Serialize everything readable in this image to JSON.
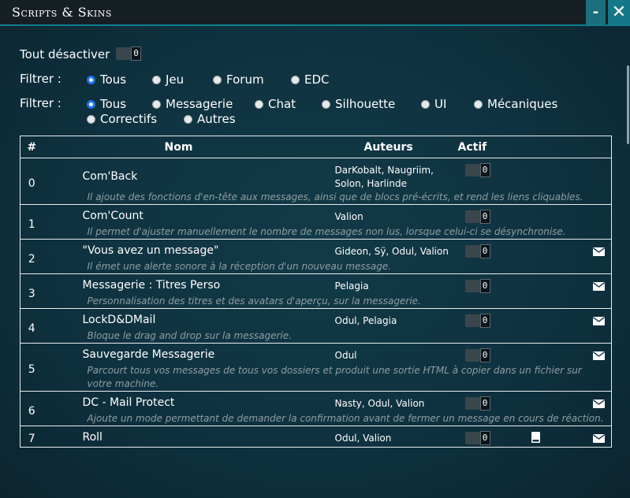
{
  "window": {
    "title": "Scripts & Skins",
    "minimize_label": "-",
    "close_label": "✕"
  },
  "disable_all": {
    "label": "Tout désactiver",
    "toggle_value": "0"
  },
  "filter1": {
    "label": "Filtrer :",
    "options": [
      {
        "label": "Tous",
        "checked": true
      },
      {
        "label": "Jeu",
        "checked": false
      },
      {
        "label": "Forum",
        "checked": false
      },
      {
        "label": "EDC",
        "checked": false
      }
    ]
  },
  "filter2": {
    "label": "Filtrer :",
    "options": [
      {
        "label": "Tous",
        "checked": true
      },
      {
        "label": "Messagerie",
        "checked": false
      },
      {
        "label": "Chat",
        "checked": false
      },
      {
        "label": "Silhouette",
        "checked": false
      },
      {
        "label": "UI",
        "checked": false
      },
      {
        "label": "Mécaniques",
        "checked": false
      },
      {
        "label": "Correctifs",
        "checked": false
      },
      {
        "label": "Autres",
        "checked": false
      }
    ]
  },
  "table": {
    "headers": {
      "num": "#",
      "name": "Nom",
      "authors": "Auteurs",
      "active": "Actif"
    },
    "rows": [
      {
        "num": "0",
        "name": "Com'Back",
        "authors": "DarKobalt, Naugriim, Solon, Harlinde",
        "toggle": "0",
        "mail_icon": false,
        "book_icon": false,
        "description": "Il ajoute des fonctions d'en-tête aux messages, ainsi que de blocs pré-écrits, et rend les liens cliquables."
      },
      {
        "num": "1",
        "name": "Com'Count",
        "authors": "Valion",
        "toggle": "0",
        "mail_icon": false,
        "book_icon": false,
        "description": "Il permet d'ajuster manuellement le nombre de messages non lus, lorsque celui-ci se désynchronise."
      },
      {
        "num": "2",
        "name": "\"Vous avez un message\"",
        "authors": "Gideon, Sÿ, Odul, Valion",
        "toggle": "0",
        "mail_icon": true,
        "book_icon": false,
        "description": "Il émet une alerte sonore à la réception d'un nouveau message."
      },
      {
        "num": "3",
        "name": "Messagerie : Titres Perso",
        "authors": "Pelagia",
        "toggle": "0",
        "mail_icon": true,
        "book_icon": false,
        "description": "Personnalisation des titres et des avatars d'aperçu, sur la messagerie."
      },
      {
        "num": "4",
        "name": "LockD&DMail",
        "authors": "Odul, Pelagia",
        "toggle": "0",
        "mail_icon": true,
        "book_icon": false,
        "description": "Bloque le drag and drop sur la messagerie."
      },
      {
        "num": "5",
        "name": "Sauvegarde Messagerie",
        "authors": "Odul",
        "toggle": "0",
        "mail_icon": true,
        "book_icon": false,
        "description": "Parcourt tous vos messages de tous vos dossiers et produit une sortie HTML à copier dans un fichier sur votre machine."
      },
      {
        "num": "6",
        "name": "DC - Mail Protect",
        "authors": "Nasty, Odul, Valion",
        "toggle": "0",
        "mail_icon": true,
        "book_icon": false,
        "description": "Ajoute un mode permettant de demander la confirmation avant de fermer un message en cours de réaction."
      },
      {
        "num": "7",
        "name": "Roll",
        "authors": "Odul, Valion",
        "toggle": "0",
        "mail_icon": true,
        "book_icon": true,
        "description": ""
      }
    ]
  },
  "icons": {
    "mail": "envelope-icon",
    "book": "book-icon"
  },
  "colors": {
    "accent": "#1b6e7c",
    "background": "#0f3240",
    "titlebar": "#161f24",
    "radio_checked": "#1a73e8",
    "description_text": "#8e9ea3"
  }
}
